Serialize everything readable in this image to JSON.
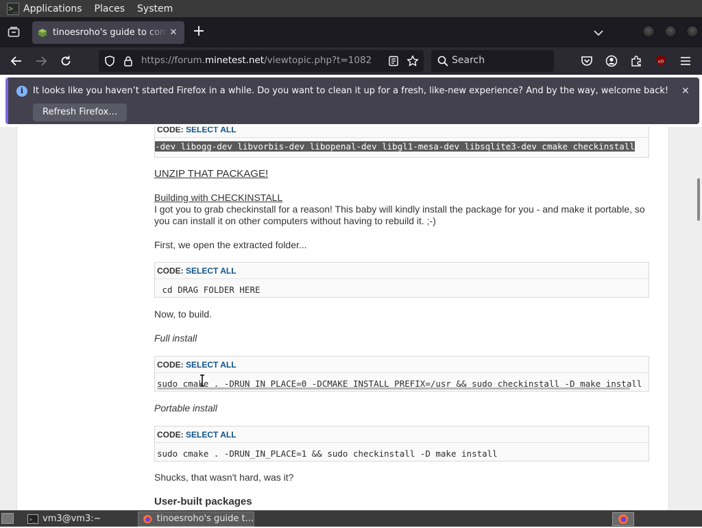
{
  "top_panel": {
    "menus": [
      "Applications",
      "Places",
      "System"
    ]
  },
  "tabs": {
    "active_title": "tinoesroho's guide to compi",
    "close_glyph": "✕",
    "new_tab_glyph": "+"
  },
  "nav": {
    "url_prefix": "https://forum.",
    "url_host": "minetest.net",
    "url_path": "/viewtopic.php?t=1082",
    "search_placeholder": "Search"
  },
  "notification": {
    "message": "It looks like you haven’t started Firefox in a while. Do you want to clean it up for a fresh, like-new experience? And by the way, welcome back!",
    "button_label": "Refresh Firefox…",
    "close_glyph": "✕"
  },
  "post": {
    "code_label": "CODE:",
    "select_all_label": "SELECT ALL",
    "code_1": "-dev libogg-dev libvorbis-dev libopenal-dev libgl1-mesa-dev libsqlite3-dev cmake checkinstall",
    "unzip_heading": "UNZIP THAT PACKAGE!",
    "building_heading": "Building with CHECKINSTALL",
    "building_text": "I got you to grab checkinstall for a reason! This baby will kindly install the package for you - and make it portable, so you can install it on other computers without having to rebuild it. ;-)",
    "first_text": "First, we open the extracted folder...",
    "code_2": " cd DRAG FOLDER HERE",
    "build_text": "Now, to build.",
    "full_install_label": "Full install",
    "code_3": "sudo cmake . -DRUN_IN_PLACE=0 -DCMAKE_INSTALL_PREFIX=/usr && sudo checkinstall -D make install",
    "portable_install_label": "Portable install",
    "code_4": "sudo cmake . -DRUN_IN_PLACE=1 && sudo checkinstall -D make install",
    "shucks_text": "Shucks, that wasn't hard, was it?",
    "user_built_heading": "User-built packages"
  },
  "taskbar": {
    "terminal_task": "vm3@vm3:~",
    "firefox_task": "tinoesroho's guide t..."
  },
  "colors": {
    "accent_link": "#105289",
    "tab_bg": "#42414d",
    "toolbar_bg": "#2b2a33"
  }
}
